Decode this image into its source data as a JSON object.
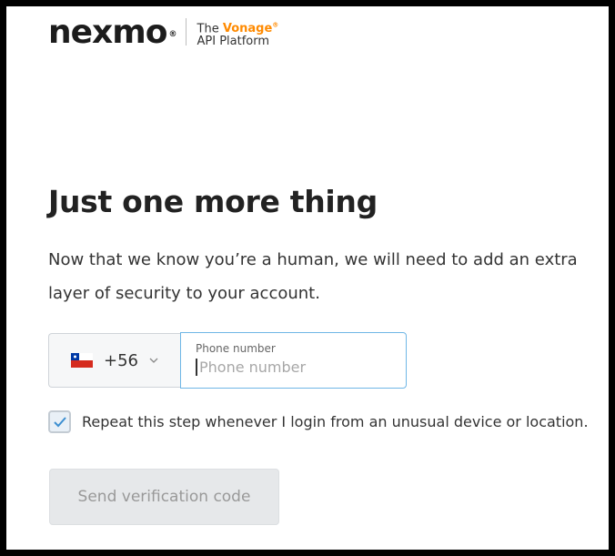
{
  "logo": {
    "wordmark": "nexmo",
    "registered": "®",
    "tagline_prefix": "The",
    "tagline_brand": "Vonage",
    "tagline_brand_mark": "®",
    "tagline_suffix": "API Platform"
  },
  "heading": "Just one more thing",
  "intro_text": "Now that we know you’re a human, we will need to add an extra layer of security to your account.",
  "phone": {
    "country_flag": "chile-flag-icon",
    "dial_code": "+56",
    "label": "Phone number",
    "placeholder": "Phone number",
    "value": ""
  },
  "repeat_step": {
    "checked": true,
    "label": "Repeat this step whenever I login from an unusual device or location."
  },
  "send_button": {
    "label": "Send verification code",
    "disabled": true
  },
  "colors": {
    "accent_orange": "#ff8a00",
    "input_focus_border": "#6fb6e6",
    "check_color": "#3d8fd1"
  }
}
